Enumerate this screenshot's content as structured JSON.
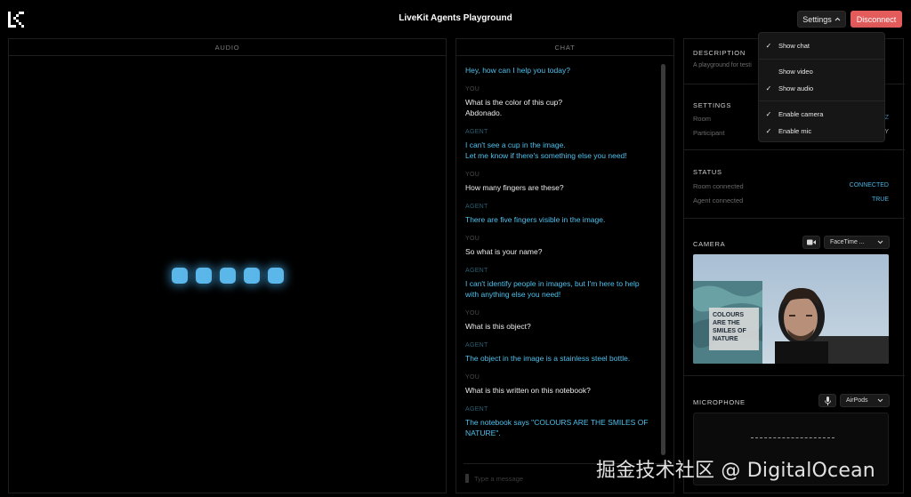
{
  "header": {
    "title": "LiveKit Agents Playground",
    "settings_label": "Settings",
    "disconnect_label": "Disconnect"
  },
  "audio_panel": {
    "title": "AUDIO",
    "visualizer_bars": 5
  },
  "chat_panel": {
    "title": "CHAT",
    "input_placeholder": "Type a message",
    "messages": [
      {
        "sender": "",
        "role": "agent",
        "text": "Hey, how can I help you today?"
      },
      {
        "sender": "YOU",
        "role": "you",
        "text": "What is the color of this cup?\nAbdonado."
      },
      {
        "sender": "AGENT",
        "role": "agent",
        "text": "I can't see a cup in the image.\nLet me know if there's something else you need!"
      },
      {
        "sender": "YOU",
        "role": "you",
        "text": "How many fingers are these?"
      },
      {
        "sender": "AGENT",
        "role": "agent",
        "text": "There are five fingers visible in the image."
      },
      {
        "sender": "YOU",
        "role": "you",
        "text": "So what is your name?"
      },
      {
        "sender": "AGENT",
        "role": "agent",
        "text": "I can't identify people in images, but I'm here to help\nwith anything else you need!"
      },
      {
        "sender": "YOU",
        "role": "you",
        "text": "What is this object?"
      },
      {
        "sender": "AGENT",
        "role": "agent",
        "text": "The object in the image is a stainless steel bottle."
      },
      {
        "sender": "YOU",
        "role": "you",
        "text": "What is this written on this notebook?"
      },
      {
        "sender": "AGENT",
        "role": "agent",
        "text": "The notebook says \"COLOURS ARE THE SMILES OF\nNATURE\"."
      }
    ]
  },
  "settings_panel": {
    "description_title": "DESCRIPTION",
    "description_text": "A playground for testi",
    "settings_title": "SETTINGS",
    "room_label": "Room",
    "room_value": "Z",
    "participant_label": "Participant",
    "participant_value": "Y",
    "status_title": "STATUS",
    "room_connected_label": "Room connected",
    "room_connected_value": "CONNECTED",
    "agent_connected_label": "Agent connected",
    "agent_connected_value": "TRUE",
    "camera_title": "CAMERA",
    "camera_device": "FaceTime ...",
    "camera_notebook_text": "COLOURS ARE THE SMILES OF NATURE",
    "microphone_title": "MICROPHONE",
    "mic_device": "AirPods"
  },
  "dropdown": {
    "items": [
      {
        "label": "Show chat",
        "checked": true
      },
      {
        "label": "Show video",
        "checked": false
      },
      {
        "label": "Show audio",
        "checked": true
      },
      {
        "label": "Enable camera",
        "checked": true
      },
      {
        "label": "Enable mic",
        "checked": true
      }
    ]
  },
  "watermark": "掘金技术社区 @ DigitalOcean",
  "colors": {
    "accent": "#4fc0ec",
    "disconnect": "#e35b5b",
    "visualizer": "#5bb7ea"
  }
}
